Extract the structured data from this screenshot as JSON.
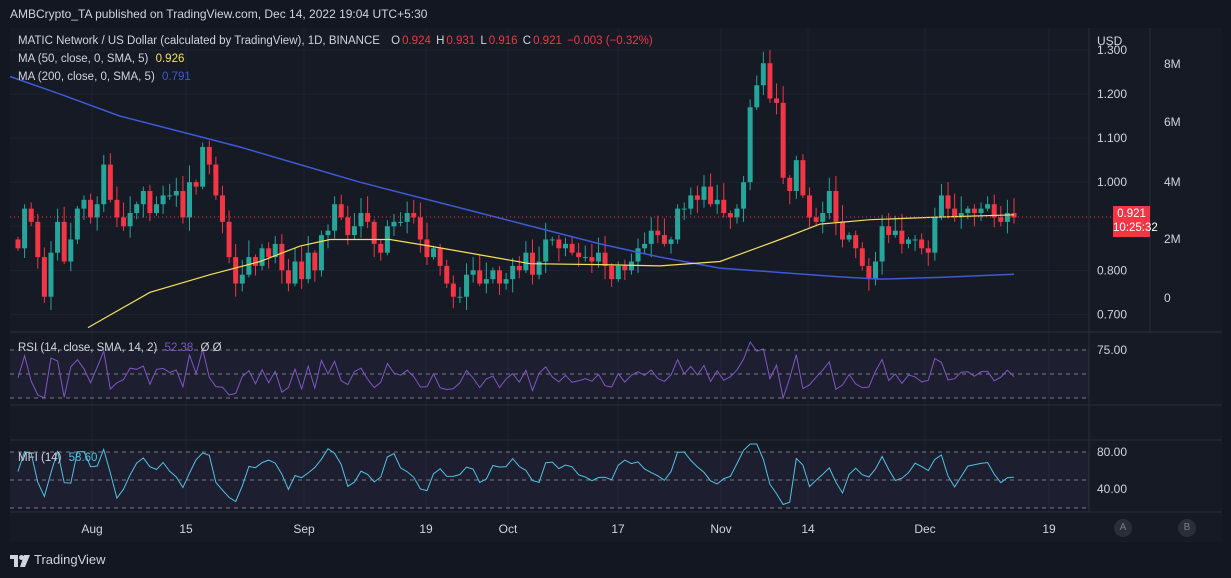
{
  "header": {
    "published": "AMBCrypto_TA published on TradingView.com, Dec 14, 2022 19:04 UTC+5:30"
  },
  "legend": {
    "symbol": "MATIC Network / US Dollar (calculated by TradingView), 1D, BINANCE",
    "o_label": "O",
    "o": "0.924",
    "h_label": "H",
    "h": "0.931",
    "l_label": "L",
    "l": "0.916",
    "c_label": "C",
    "c": "0.921",
    "change": "−0.003 (−0.32%)",
    "ma50_label": "MA (50, close, 0, SMA, 5)",
    "ma50_value": "0.926",
    "ma200_label": "MA (200, close, 0, SMA, 5)",
    "ma200_value": "0.791",
    "rsi_label": "RSI (14, close, SMA, 14, 2)",
    "rsi_value": "52.38",
    "rsi_extra": "Ø Ø",
    "mfi_label": "MFI (14)",
    "mfi_value": "58.60"
  },
  "price_axis": {
    "currency": "USD",
    "ticks": [
      "1.300",
      "1.200",
      "1.100",
      "1.000",
      "0.800",
      "0.700"
    ],
    "last_price": "0.921",
    "countdown": "10:25:32"
  },
  "volume_axis": {
    "ticks": [
      "8M",
      "6M",
      "4M",
      "2M",
      "0"
    ]
  },
  "rsi_axis": {
    "ticks": [
      "75.00"
    ]
  },
  "mfi_axis": {
    "ticks": [
      "80.00",
      "40.00"
    ]
  },
  "time_axis": {
    "ticks": [
      "Aug",
      "15",
      "Sep",
      "19",
      "Oct",
      "17",
      "Nov",
      "14",
      "Dec",
      "19"
    ]
  },
  "axis_buttons": {
    "a": "A",
    "b": "B"
  },
  "footer": {
    "brand": "TradingView"
  },
  "colors": {
    "up": "#26a69a",
    "down": "#f23645",
    "ma50": "#f5e05b",
    "ma200": "#3e5ad6",
    "rsi": "#7e57c2",
    "mfi": "#4fc3e0",
    "bg": "#131722"
  },
  "chart_data": [
    {
      "type": "candlestick",
      "title": "MATIC Network / US Dollar (calculated by TradingView), 1D, BINANCE",
      "ylabel": "USD",
      "ylim": [
        0.66,
        1.35
      ],
      "x_range": [
        "2022-07-21",
        "2022-12-14"
      ],
      "close": [
        0.85,
        0.94,
        0.91,
        0.83,
        0.74,
        0.84,
        0.91,
        0.82,
        0.87,
        0.94,
        0.96,
        0.92,
        0.95,
        1.04,
        0.96,
        0.92,
        0.9,
        0.93,
        0.95,
        0.98,
        0.93,
        0.95,
        0.97,
        0.97,
        0.98,
        0.92,
        1.0,
        0.99,
        1.08,
        1.04,
        0.97,
        0.91,
        0.83,
        0.77,
        0.79,
        0.83,
        0.81,
        0.85,
        0.83,
        0.86,
        0.8,
        0.77,
        0.82,
        0.78,
        0.84,
        0.8,
        0.88,
        0.89,
        0.95,
        0.92,
        0.88,
        0.9,
        0.93,
        0.91,
        0.86,
        0.84,
        0.9,
        0.91,
        0.91,
        0.93,
        0.92,
        0.87,
        0.83,
        0.85,
        0.81,
        0.77,
        0.74,
        0.74,
        0.79,
        0.8,
        0.77,
        0.78,
        0.8,
        0.77,
        0.78,
        0.81,
        0.8,
        0.84,
        0.79,
        0.82,
        0.87,
        0.87,
        0.85,
        0.86,
        0.84,
        0.83,
        0.83,
        0.82,
        0.84,
        0.81,
        0.78,
        0.81,
        0.8,
        0.82,
        0.85,
        0.86,
        0.89,
        0.88,
        0.86,
        0.87,
        0.94,
        0.94,
        0.97,
        0.96,
        0.99,
        0.95,
        0.96,
        0.93,
        0.92,
        0.94,
        1.0,
        1.17,
        1.22,
        1.27,
        1.19,
        1.18,
        1.01,
        0.98,
        1.05,
        0.97,
        0.92,
        0.91,
        0.93,
        0.98,
        0.91,
        0.87,
        0.88,
        0.85,
        0.81,
        0.78,
        0.82,
        0.9,
        0.88,
        0.89,
        0.86,
        0.87,
        0.87,
        0.85,
        0.84,
        0.92,
        0.97,
        0.94,
        0.92,
        0.93,
        0.94,
        0.93,
        0.94,
        0.95,
        0.92,
        0.91,
        0.93,
        0.92
      ],
      "series": [
        {
          "name": "MA (50, close, 0, SMA, 5)",
          "start": [
            0.67,
            0.72
          ],
          "end": [
            0.94,
            0.926
          ]
        },
        {
          "name": "MA (200, close, 0, SMA, 5)",
          "start": [
            1.24
          ],
          "end": [
            0.791
          ]
        },
        {
          "name": "RSI (14, close, SMA, 14, 2)",
          "range": [
            30,
            80
          ],
          "last": 52.38
        },
        {
          "name": "MFI (14)",
          "range": [
            20,
            85
          ],
          "last": 58.6
        }
      ],
      "volume_range": [
        0,
        8000000
      ]
    }
  ]
}
